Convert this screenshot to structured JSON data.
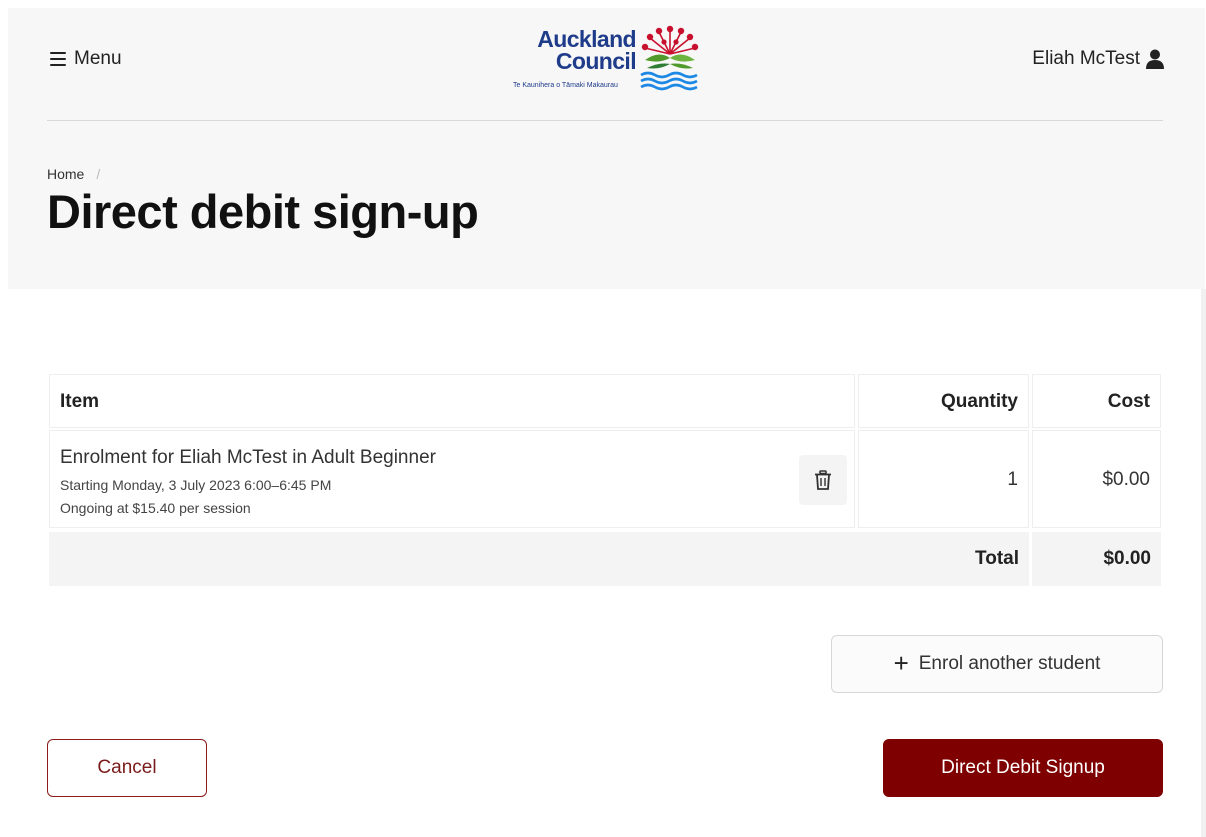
{
  "header": {
    "menu_label": "Menu",
    "logo_line1": "Auckland",
    "logo_line2": "Council",
    "logo_tagline": "Te Kaunihera o Tāmaki Makaurau",
    "user_name": "Eliah McTest"
  },
  "breadcrumb": {
    "home": "Home",
    "separator": "/"
  },
  "page_title": "Direct debit sign-up",
  "cart": {
    "columns": {
      "item": "Item",
      "quantity": "Quantity",
      "cost": "Cost"
    },
    "items": [
      {
        "title": "Enrolment for Eliah McTest in Adult Beginner",
        "schedule": "Starting Monday, 3 July 2023 6:00–6:45 PM",
        "pricing": "Ongoing at $15.40 per session",
        "quantity": "1",
        "cost": "$0.00"
      }
    ],
    "total_label": "Total",
    "total_value": "$0.00"
  },
  "actions": {
    "enrol_another": "Enrol another student",
    "cancel": "Cancel",
    "signup": "Direct Debit Signup"
  },
  "colors": {
    "primary": "#7f0000",
    "brand_blue": "#1f3c8b",
    "header_bg": "#f7f7f7"
  },
  "icons": {
    "menu": "hamburger-icon",
    "user": "user-icon",
    "delete": "trash-icon",
    "add": "plus-icon"
  }
}
